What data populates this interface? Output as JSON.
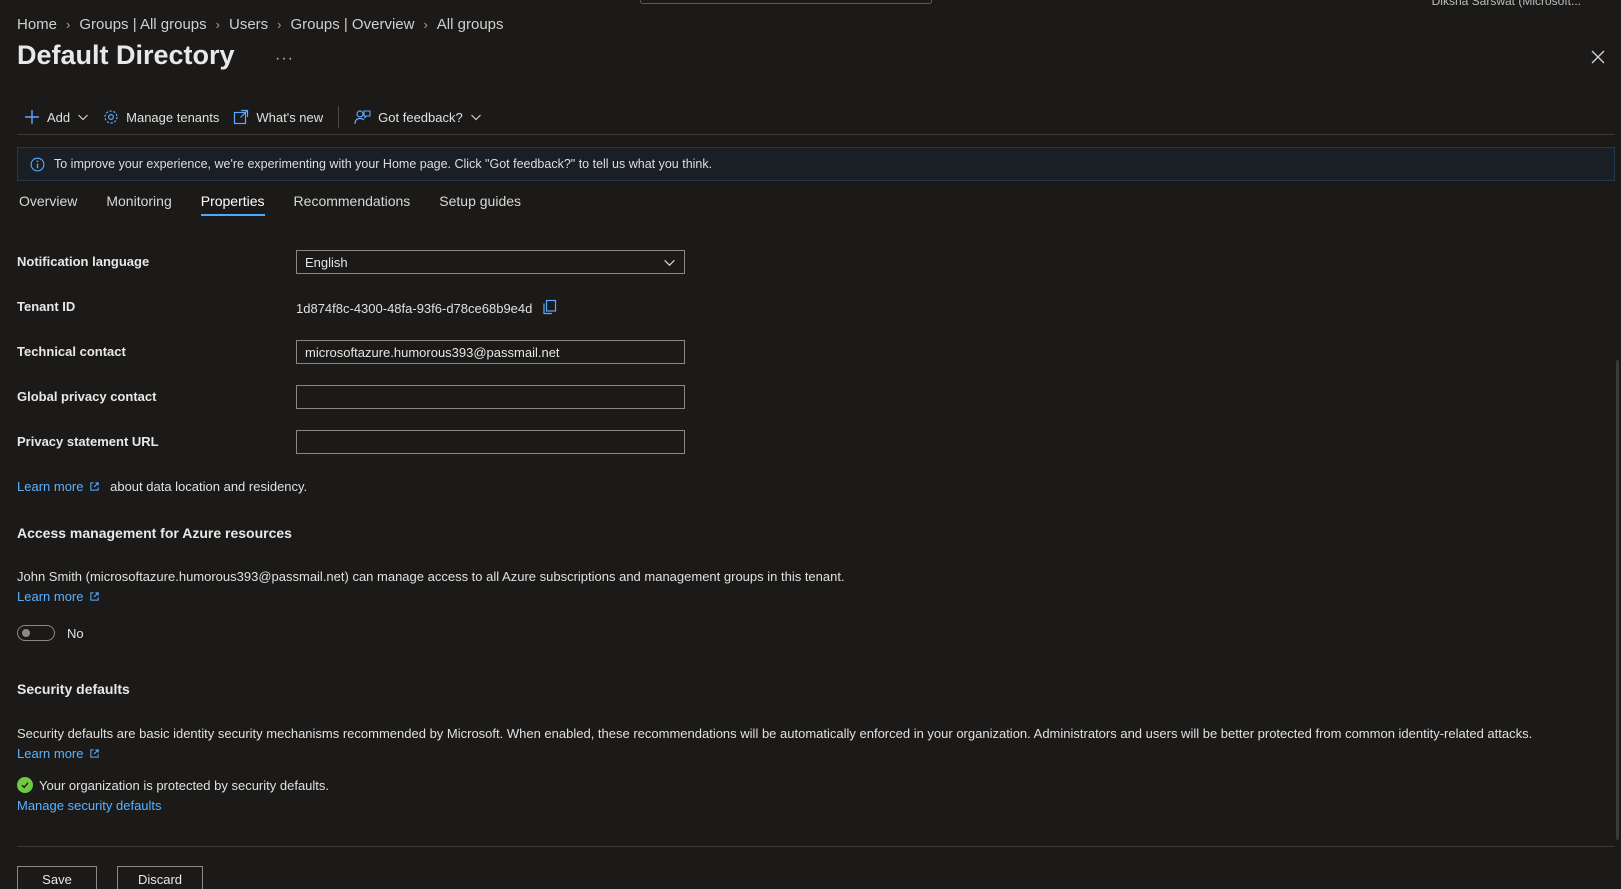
{
  "topbar": {
    "account": "Diksha Sarswat (Microsoft..."
  },
  "breadcrumb": [
    "Home",
    "Groups | All groups",
    "Users",
    "Groups | Overview",
    "All groups"
  ],
  "page": {
    "title": "Default Directory",
    "more": "···"
  },
  "commands": {
    "add": "Add",
    "manage_tenants": "Manage tenants",
    "whats_new": "What's new",
    "feedback": "Got feedback?"
  },
  "banner": {
    "text": "To improve your experience, we're experimenting with your Home page. Click \"Got feedback?\" to tell us what you think."
  },
  "tabs": [
    "Overview",
    "Monitoring",
    "Properties",
    "Recommendations",
    "Setup guides"
  ],
  "active_tab": "Properties",
  "form": {
    "notification_language": {
      "label": "Notification language",
      "value": "English"
    },
    "tenant_id": {
      "label": "Tenant ID",
      "value": "1d874f8c-4300-48fa-93f6-d78ce68b9e4d"
    },
    "technical_contact": {
      "label": "Technical contact",
      "value": "microsoftazure.humorous393@passmail.net"
    },
    "global_privacy_contact": {
      "label": "Global privacy contact",
      "value": ""
    },
    "privacy_statement_url": {
      "label": "Privacy statement URL",
      "value": ""
    }
  },
  "data_location": {
    "link": "Learn more",
    "text": "about data location and residency."
  },
  "access_management": {
    "heading": "Access management for Azure resources",
    "description": "John Smith (microsoftazure.humorous393@passmail.net) can manage access to all Azure subscriptions and management groups in this tenant.",
    "link": "Learn more",
    "toggle_label": "No"
  },
  "security_defaults": {
    "heading": "Security defaults",
    "description": "Security defaults are basic identity security mechanisms recommended by Microsoft. When enabled, these recommendations will be automatically enforced in your organization. Administrators and users will be better protected from common identity-related attacks.",
    "link": "Learn more",
    "status": "Your organization is protected by security defaults.",
    "manage_link": "Manage security defaults"
  },
  "footer": {
    "save": "Save",
    "discard": "Discard"
  },
  "colors": {
    "accent": "#4aa8ff",
    "link": "#58b2ff",
    "success": "#6ccb3f",
    "background": "#1b1a19"
  }
}
